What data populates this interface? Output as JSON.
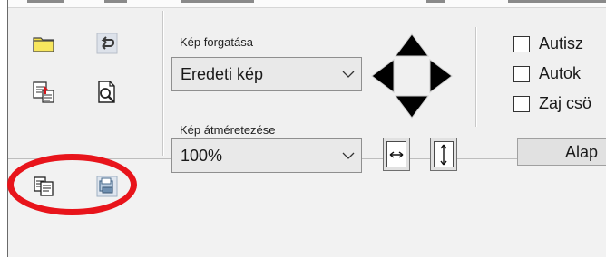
{
  "rotation": {
    "label": "Kép forgatása",
    "selected": "Eredeti kép"
  },
  "resize": {
    "label": "Kép átméretezése",
    "selected": "100%"
  },
  "options": [
    {
      "label": "Autisz",
      "checked": false
    },
    {
      "label": "Autok",
      "checked": false
    },
    {
      "label": "Zaj csö",
      "checked": false
    }
  ],
  "reset_button_label": "Alap",
  "icons": {
    "open": "folder-icon",
    "undo": "undo-arrow-icon",
    "export": "export-document-icon",
    "preview": "print-preview-icon",
    "copy": "copy-icon",
    "scan": "scan-icon",
    "rotate_pad": "four-direction-arrows-icon",
    "fit_width": "fit-width-icon",
    "fit_height": "fit-height-icon"
  },
  "colors": {
    "highlight_circle": "#e8141b",
    "folder": "#f4e04a"
  }
}
